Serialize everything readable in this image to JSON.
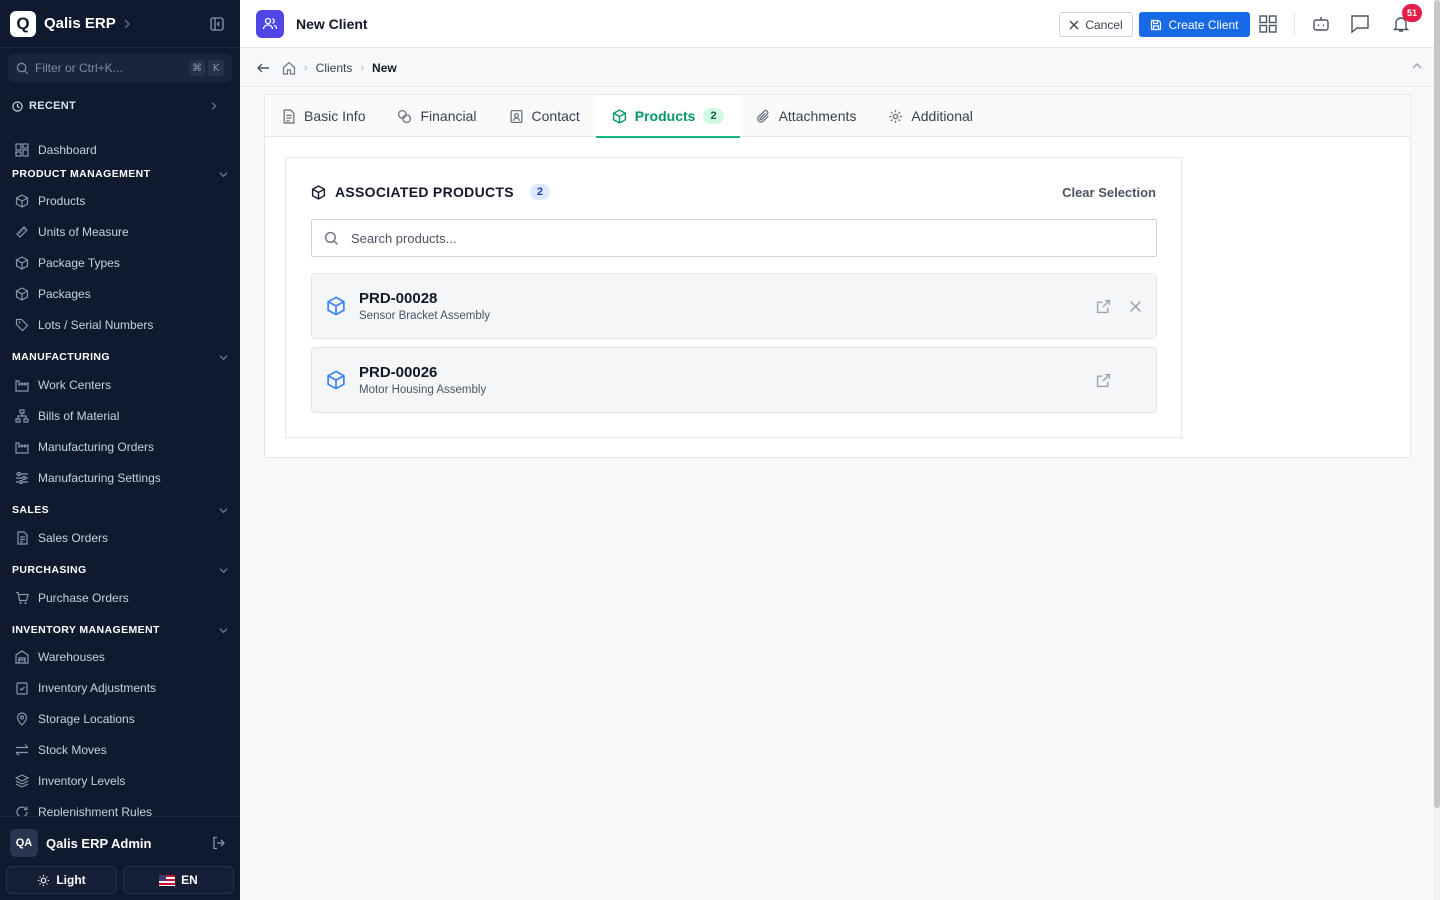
{
  "app": {
    "logo_letter": "Q",
    "name": "Qalis ERP"
  },
  "sidebar": {
    "filter_placeholder": "Filter or Ctrl+K...",
    "filter_keys": [
      "⌘",
      "K"
    ],
    "recent_label": "RECENT",
    "dashboard_label": "Dashboard",
    "sections": [
      {
        "title": "PRODUCT MANAGEMENT",
        "items": [
          "Products",
          "Units of Measure",
          "Package Types",
          "Packages",
          "Lots / Serial Numbers"
        ]
      },
      {
        "title": "MANUFACTURING",
        "items": [
          "Work Centers",
          "Bills of Material",
          "Manufacturing Orders",
          "Manufacturing Settings"
        ]
      },
      {
        "title": "SALES",
        "items": [
          "Sales Orders"
        ]
      },
      {
        "title": "PURCHASING",
        "items": [
          "Purchase Orders"
        ]
      },
      {
        "title": "INVENTORY MANAGEMENT",
        "items": [
          "Warehouses",
          "Inventory Adjustments",
          "Storage Locations",
          "Stock Moves",
          "Inventory Levels",
          "Replenishment Rules"
        ]
      }
    ],
    "user": {
      "initials": "QA",
      "name": "Qalis ERP Admin"
    },
    "theme_label": "Light",
    "language_label": "EN"
  },
  "topbar": {
    "title": "New Client",
    "cancel_label": "Cancel",
    "create_label": "Create Client",
    "notification_count": "51"
  },
  "breadcrumb": {
    "items": [
      "Clients",
      "New"
    ]
  },
  "tabs": [
    {
      "label": "Basic Info",
      "icon": "document-icon"
    },
    {
      "label": "Financial",
      "icon": "coins-icon"
    },
    {
      "label": "Contact",
      "icon": "contact-icon"
    },
    {
      "label": "Products",
      "icon": "box-icon",
      "count": "2",
      "active": true
    },
    {
      "label": "Attachments",
      "icon": "paperclip-icon"
    },
    {
      "label": "Additional",
      "icon": "gear-icon"
    }
  ],
  "products_panel": {
    "title": "ASSOCIATED PRODUCTS",
    "count": "2",
    "clear_label": "Clear Selection",
    "search_placeholder": "Search products...",
    "items": [
      {
        "code": "PRD-00028",
        "name": "Sensor Bracket Assembly",
        "removable": true
      },
      {
        "code": "PRD-00026",
        "name": "Motor Housing Assembly",
        "removable": false
      }
    ]
  },
  "colors": {
    "sidebar_bg": "#0f1a2e",
    "primary": "#1769e6",
    "active_tab": "#059669",
    "notification": "#e11d48"
  }
}
